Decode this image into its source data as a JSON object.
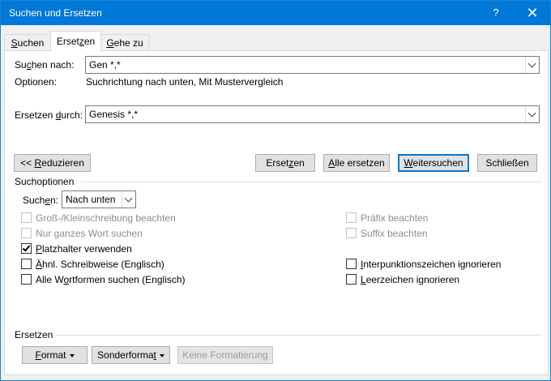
{
  "window": {
    "title": "Suchen und Ersetzen",
    "help": "?",
    "close": "✕"
  },
  "tabs": [
    {
      "label": "Suchen",
      "u": "S",
      "rest": "uchen"
    },
    {
      "label": "Ersetzen",
      "pre": "Erset",
      "u": "z",
      "rest": "en",
      "active": true
    },
    {
      "label": "Gehe zu",
      "u": "G",
      "rest": "ehe zu"
    }
  ],
  "find": {
    "label_pre": "Su",
    "label_u": "c",
    "label_rest": "hen nach:",
    "value": "Gen *,*",
    "options_label": "Optionen:",
    "options_value": "Suchrichtung nach unten, Mit Mustervergleich"
  },
  "replace": {
    "label_pre": "Ersetzen ",
    "label_u": "d",
    "label_rest": "urch:",
    "value": "Genesis *,*"
  },
  "buttons": {
    "reduce_pre": "<< ",
    "reduce_u": "R",
    "reduce_rest": "eduzieren",
    "replace_pre": "Erset",
    "replace_u": "z",
    "replace_rest": "en",
    "replace_all_pre": "",
    "replace_all_u": "A",
    "replace_all_rest": "lle ersetzen",
    "find_next_pre": "",
    "find_next_u": "W",
    "find_next_rest": "eitersuchen",
    "close": "Schließen"
  },
  "search_options": {
    "title": "Suchoptionen",
    "direction_label_pre": "Such",
    "direction_label_u": "e",
    "direction_label_rest": "n:",
    "direction_value": "Nach unten",
    "left": [
      {
        "label": "Groß-/Kleinschreibung beachten",
        "checked": false,
        "disabled": true
      },
      {
        "label": "Nur ganzes Wort suchen",
        "checked": false,
        "disabled": true
      },
      {
        "pre": "",
        "u": "P",
        "rest": "latzhalter verwenden",
        "label": "Platzhalter verwenden",
        "checked": true,
        "disabled": false
      },
      {
        "pre": "",
        "u": "Ä",
        "rest": "hnl. Schreibweise (Englisch)",
        "label": "Ähnl. Schreibweise (Englisch)",
        "checked": false,
        "disabled": false
      },
      {
        "pre": "Alle W",
        "u": "o",
        "rest": "rtformen suchen (Englisch)",
        "label": "Alle Wortformen suchen (Englisch)",
        "checked": false,
        "disabled": false
      }
    ],
    "right": [
      {
        "label": "Präfix beachten",
        "checked": false,
        "disabled": true
      },
      {
        "label": "Suffix beachten",
        "checked": false,
        "disabled": true
      },
      {
        "pre": "",
        "u": "I",
        "rest": "nterpunktionszeichen ignorieren",
        "label": "Interpunktionszeichen ignorieren",
        "checked": false,
        "disabled": false
      },
      {
        "pre": "",
        "u": "L",
        "rest": "eerzeichen ignorieren",
        "label": "Leerzeichen ignorieren",
        "checked": false,
        "disabled": false
      }
    ]
  },
  "replace_section": {
    "title": "Ersetzen",
    "format_pre": "",
    "format_u": "F",
    "format_rest": "ormat",
    "special_pre": "Sonderforma",
    "special_u": "t",
    "special_rest": "",
    "no_format": "Keine Formatierung"
  }
}
